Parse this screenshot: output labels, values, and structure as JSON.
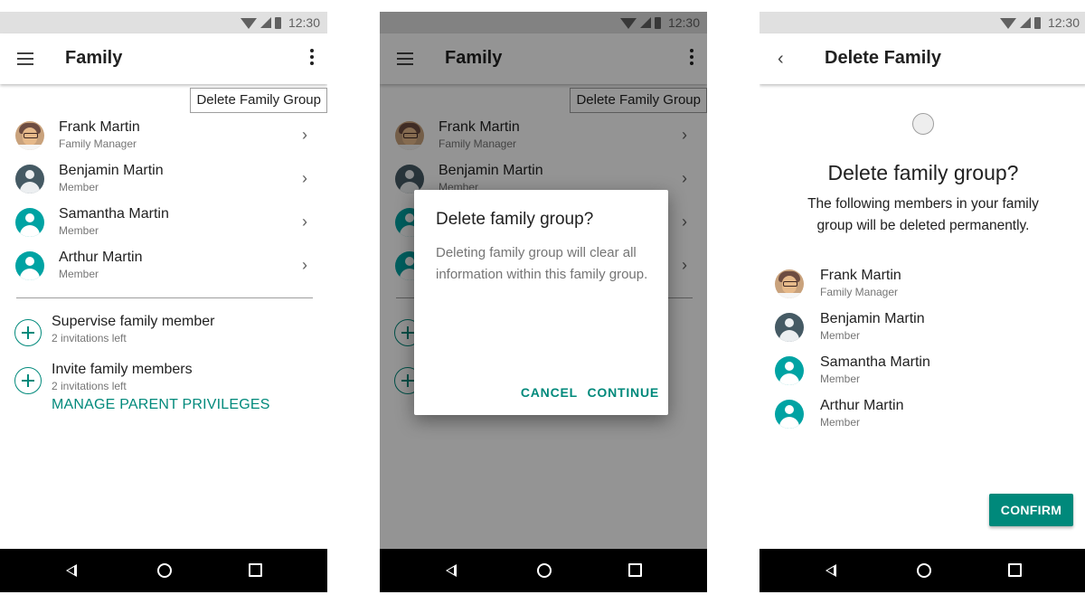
{
  "status_bar": {
    "time": "12:30"
  },
  "family_screen": {
    "title": "Family",
    "overflow_menu_item": "Delete Family Group",
    "members": [
      {
        "name": "Frank Martin",
        "role": "Family Manager",
        "avatar": "photo-avatar"
      },
      {
        "name": "Benjamin Martin",
        "role": "Member",
        "avatar": "person-icon-dark"
      },
      {
        "name": "Samantha Martin",
        "role": "Member",
        "avatar": "person-icon-teal"
      },
      {
        "name": "Arthur Martin",
        "role": "Member",
        "avatar": "person-icon-teal"
      }
    ],
    "actions": [
      {
        "title": "Supervise family member",
        "subtitle": "2 invitations left"
      },
      {
        "title": "Invite family members",
        "subtitle": "2 invitations left"
      }
    ],
    "manage_link": "MANAGE PARENT PRIVILEGES"
  },
  "dialog": {
    "title": "Delete family group?",
    "body": "Deleting family group will clear all information within this family group.",
    "cancel_label": "CANCEL",
    "continue_label": "CONTINUE"
  },
  "delete_screen": {
    "title": "Delete Family",
    "heading": "Delete family group?",
    "body": "The following members in your family group will be deleted permanently.",
    "confirm_label": "CONFIRM"
  },
  "colors": {
    "accent": "#00897b",
    "avatar_teal": "#00a3a3",
    "avatar_dark": "#455a64",
    "scrim": "#6b6b6b"
  }
}
